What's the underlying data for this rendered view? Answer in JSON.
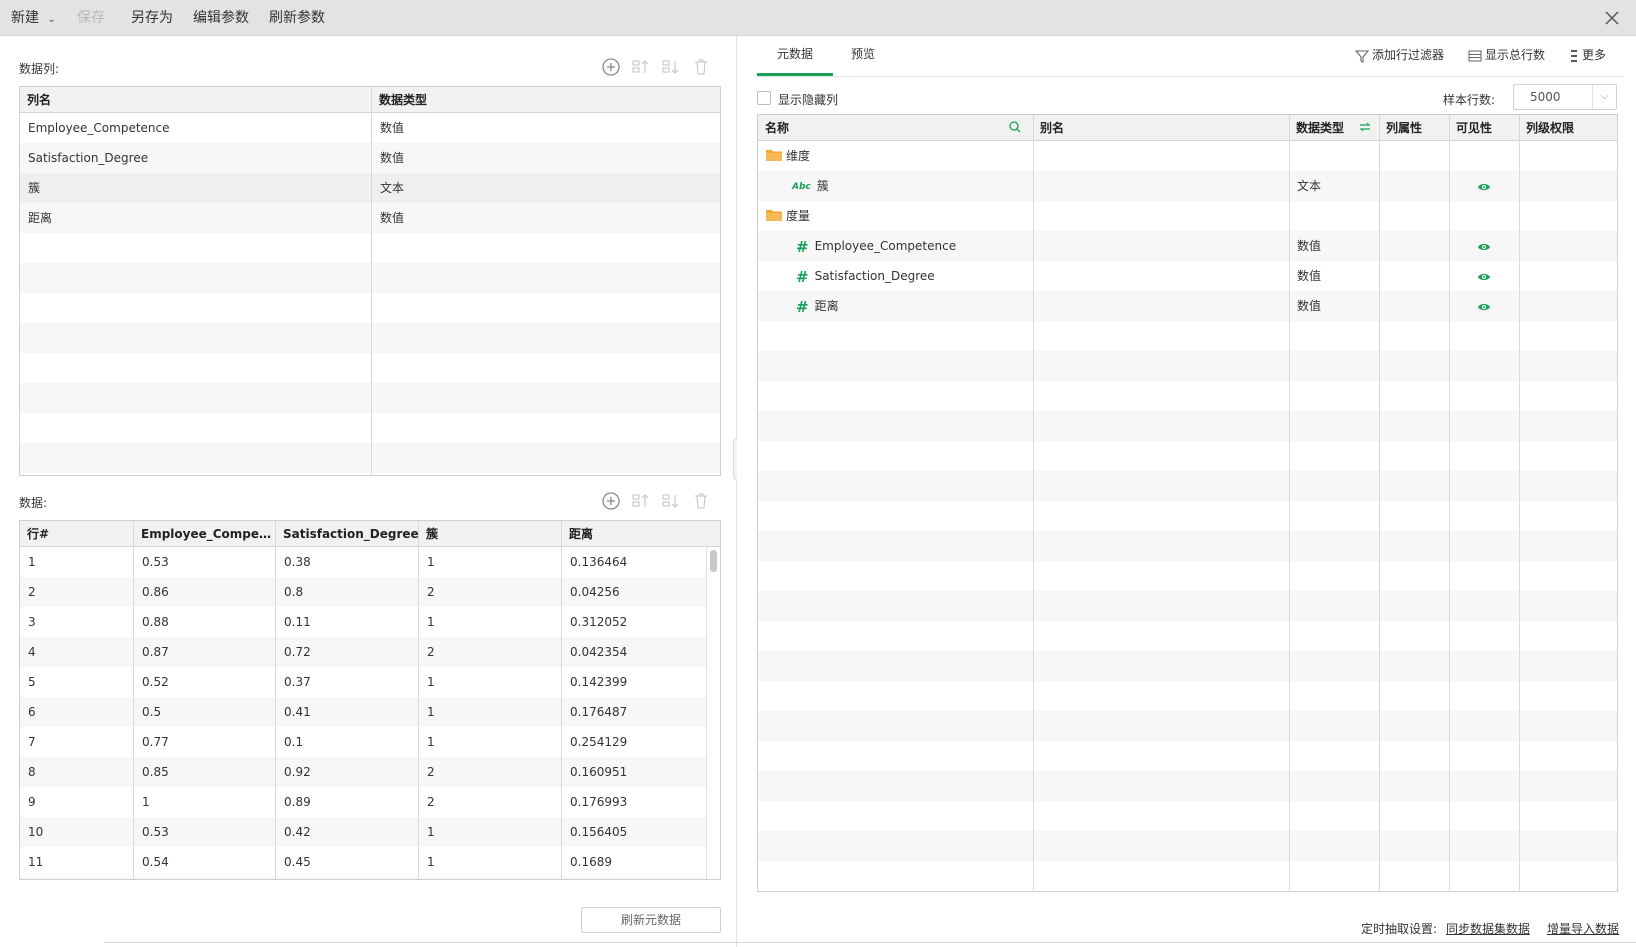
{
  "toolbar": {
    "new_label": "新建",
    "save_label": "保存",
    "save_as_label": "另存为",
    "edit_params_label": "编辑参数",
    "refresh_params_label": "刷新参数"
  },
  "left": {
    "columns_section_label": "数据列:",
    "columns_table": {
      "headers": [
        "列名",
        "数据类型"
      ],
      "rows": [
        [
          "Employee_Competence",
          "数值"
        ],
        [
          "Satisfaction_Degree",
          "数值"
        ],
        [
          "簇",
          "文本"
        ],
        [
          "距离",
          "数值"
        ]
      ]
    },
    "data_section_label": "数据:",
    "data_table": {
      "headers": [
        "行#",
        "Employee_Compete···",
        "Satisfaction_Degree",
        "簇",
        "距离"
      ],
      "rows": [
        [
          "1",
          "0.53",
          "0.38",
          "1",
          "0.136464"
        ],
        [
          "2",
          "0.86",
          "0.8",
          "2",
          "0.04256"
        ],
        [
          "3",
          "0.88",
          "0.11",
          "1",
          "0.312052"
        ],
        [
          "4",
          "0.87",
          "0.72",
          "2",
          "0.042354"
        ],
        [
          "5",
          "0.52",
          "0.37",
          "1",
          "0.142399"
        ],
        [
          "6",
          "0.5",
          "0.41",
          "1",
          "0.176487"
        ],
        [
          "7",
          "0.77",
          "0.1",
          "1",
          "0.254129"
        ],
        [
          "8",
          "0.85",
          "0.92",
          "2",
          "0.160951"
        ],
        [
          "9",
          "1",
          "0.89",
          "2",
          "0.176993"
        ],
        [
          "10",
          "0.53",
          "0.42",
          "1",
          "0.156405"
        ],
        [
          "11",
          "0.54",
          "0.45",
          "1",
          "0.1689"
        ]
      ]
    },
    "refresh_metadata_label": "刷新元数据"
  },
  "right": {
    "tabs": [
      "元数据",
      "预览"
    ],
    "active_tab": "元数据",
    "add_row_filter_label": "添加行过滤器",
    "show_total_rows_label": "显示总行数",
    "more_label": "更多",
    "show_hidden_columns_label": "显示隐藏列",
    "sample_rows_label": "样本行数:",
    "sample_rows_value": "5000",
    "meta_table": {
      "headers": [
        "名称",
        "别名",
        "数据类型",
        "列属性",
        "可见性",
        "列级权限"
      ],
      "rows": [
        {
          "kind": "folder",
          "name": "维度",
          "type": ""
        },
        {
          "kind": "text",
          "name": "簇",
          "type": "文本",
          "visible": true
        },
        {
          "kind": "folder",
          "name": "度量",
          "type": ""
        },
        {
          "kind": "number",
          "name": "Employee_Competence",
          "type": "数值",
          "visible": true
        },
        {
          "kind": "number",
          "name": "Satisfaction_Degree",
          "type": "数值",
          "visible": true
        },
        {
          "kind": "number",
          "name": "距离",
          "type": "数值",
          "visible": true
        }
      ]
    },
    "footer": {
      "schedule_label": "定时抽取设置:",
      "sync_link": "同步数据集数据",
      "incremental_link": "增量导入数据"
    }
  },
  "colors": {
    "accent": "#1aa058",
    "folder": "#f4a534",
    "toolbar_bg": "#e3e3e3"
  }
}
